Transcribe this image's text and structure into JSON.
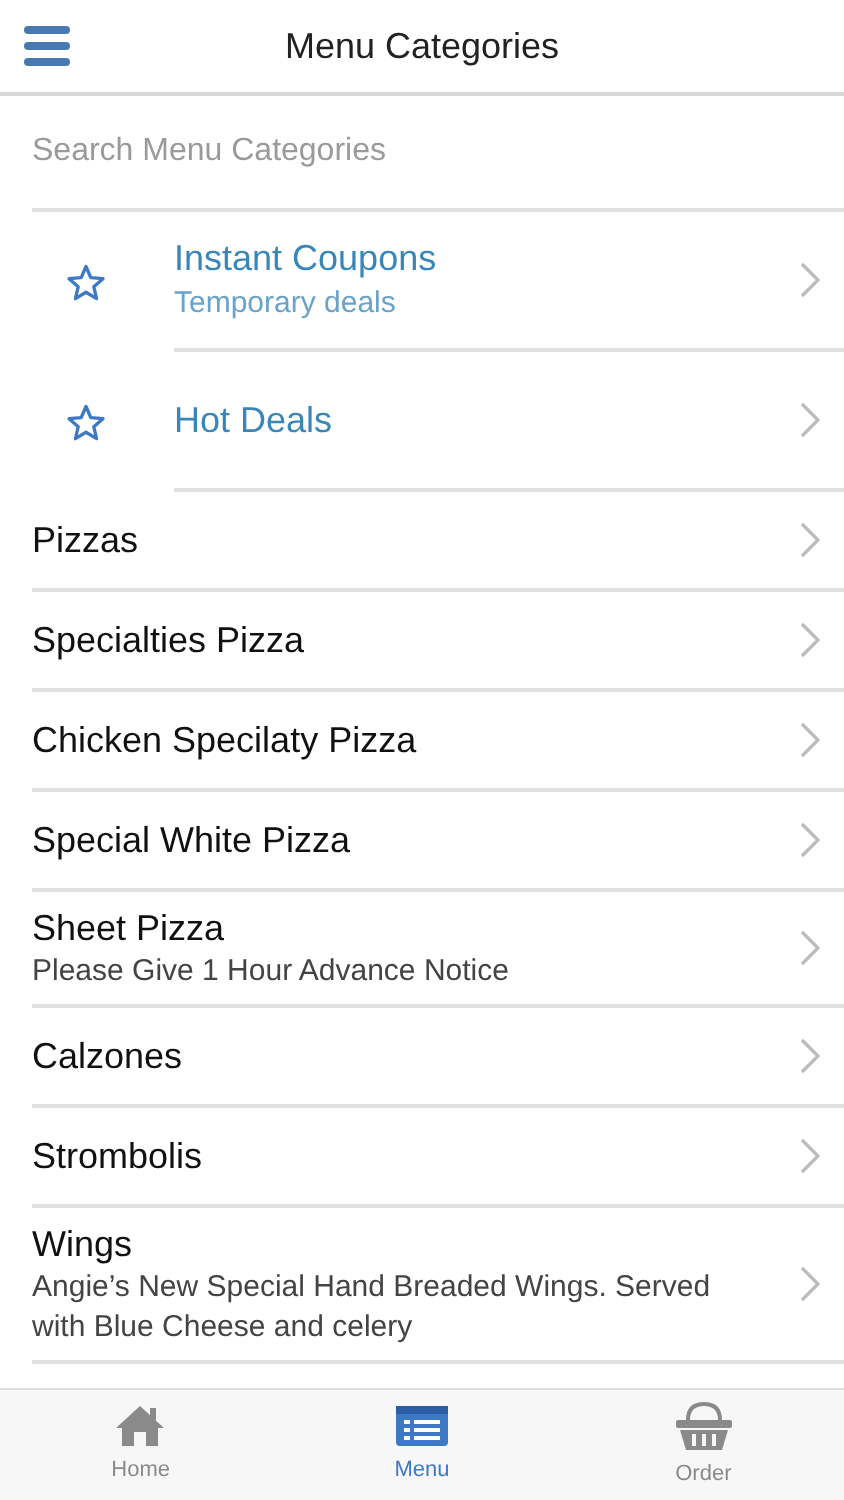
{
  "header": {
    "title": "Menu Categories"
  },
  "search": {
    "placeholder": "Search Menu Categories"
  },
  "featured": [
    {
      "title": "Instant Coupons",
      "subtitle": "Temporary deals"
    },
    {
      "title": "Hot Deals"
    }
  ],
  "categories": [
    {
      "title": "Pizzas"
    },
    {
      "title": "Specialties Pizza"
    },
    {
      "title": "Chicken Specilaty Pizza"
    },
    {
      "title": "Special White Pizza"
    },
    {
      "title": "Sheet Pizza",
      "subtitle": "Please Give 1 Hour Advance Notice"
    },
    {
      "title": "Calzones"
    },
    {
      "title": "Strombolis"
    },
    {
      "title": "Wings",
      "subtitle": "Angie’s New Special Hand Breaded Wings. Served with Blue Cheese and celery"
    }
  ],
  "tab_bar": [
    {
      "label": "Home",
      "kind": "home",
      "selected": false
    },
    {
      "label": "Menu",
      "kind": "menu",
      "selected": true
    },
    {
      "label": "Order",
      "kind": "basket",
      "selected": false
    }
  ]
}
